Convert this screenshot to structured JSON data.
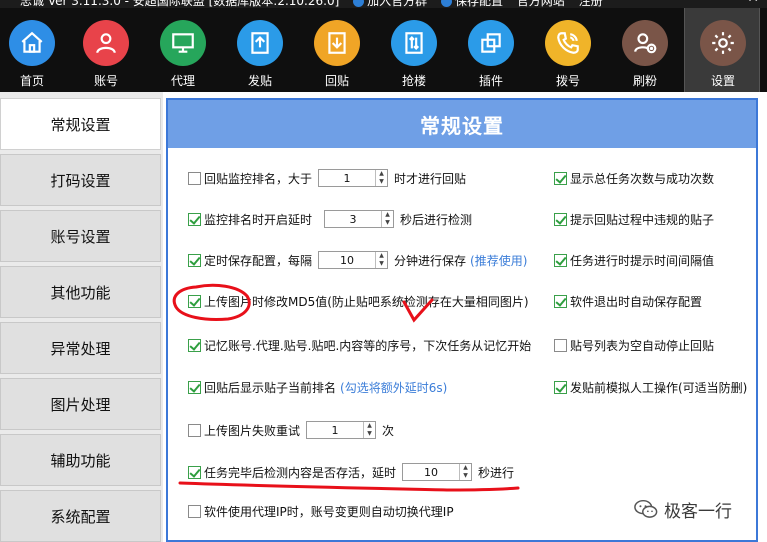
{
  "titlebar": {
    "title": "忠诚 Ver 3.11.3.0 - 安超国际联盟 [数据库版本:2.10.26.0]",
    "links": [
      "加入官方群",
      "保存配置",
      "官方网站",
      "注册"
    ],
    "close": "✕"
  },
  "toolbar": {
    "items": [
      {
        "label": "首页",
        "icon": "home-icon",
        "color": "#2e8ee6"
      },
      {
        "label": "账号",
        "icon": "user-icon",
        "color": "#e8434a"
      },
      {
        "label": "代理",
        "icon": "monitor-icon",
        "color": "#26a65b"
      },
      {
        "label": "发贴",
        "icon": "upload-icon",
        "color": "#2b9be8"
      },
      {
        "label": "回贴",
        "icon": "download-icon",
        "color": "#f0a526"
      },
      {
        "label": "抢楼",
        "icon": "sort-icon",
        "color": "#2b9be8"
      },
      {
        "label": "插件",
        "icon": "layers-icon",
        "color": "#2b9be8"
      },
      {
        "label": "拨号",
        "icon": "phone-icon",
        "color": "#f0b429"
      },
      {
        "label": "刷粉",
        "icon": "add-user-icon",
        "color": "#7a5548"
      },
      {
        "label": "设置",
        "icon": "gear-icon",
        "color": "#7a5548"
      }
    ],
    "active_index": 9
  },
  "sidebar": {
    "items": [
      "常规设置",
      "打码设置",
      "账号设置",
      "其他功能",
      "异常处理",
      "图片处理",
      "辅助功能",
      "系统配置"
    ],
    "active_index": 0
  },
  "panel": {
    "title": "常规设置",
    "left_options": [
      {
        "pre": "回贴监控排名，大于",
        "value": "1",
        "post": "时才进行回贴",
        "checked": false
      },
      {
        "pre": "监控排名时开启延时",
        "value": "3",
        "post": "秒后进行检测",
        "checked": true
      },
      {
        "pre": "定时保存配置，每隔",
        "value": "10",
        "post": "分钟进行保存",
        "hint": "(推荐使用)",
        "checked": true
      },
      {
        "pre": "上传图片时修改MD5值(防止贴吧系统检测存在大量相同图片)",
        "checked": true
      },
      {
        "pre": "记忆账号.代理.贴号.贴吧.内容等的序号，下次任务从记忆开始",
        "checked": true
      },
      {
        "pre": "回贴后显示贴子当前排名",
        "hint": "(勾选将额外延时6s)",
        "checked": true
      },
      {
        "pre": "上传图片失败重试",
        "value": "1",
        "post": "次",
        "checked": false
      },
      {
        "pre": "任务完毕后检测内容是否存活，延时",
        "value": "10",
        "post": "秒进行",
        "checked": true
      },
      {
        "pre": "软件使用代理IP时，账号变更则自动切换代理IP",
        "checked": false
      }
    ],
    "right_options": [
      {
        "label": "显示总任务次数与成功次数",
        "checked": true
      },
      {
        "label": "提示回贴过程中违规的贴子",
        "checked": true
      },
      {
        "label": "任务进行时提示时间间隔值",
        "checked": true
      },
      {
        "label": "软件退出时自动保存配置",
        "checked": true
      },
      {
        "label": "贴号列表为空自动停止回贴",
        "checked": false
      },
      {
        "label": "发贴前模拟人工操作(可适当防删)",
        "checked": true
      }
    ]
  },
  "watermark": {
    "text": "极客一行",
    "icon": "wechat-icon"
  },
  "colors": {
    "accent": "#3c78d8",
    "header": "#6f9fe6",
    "check": "#2e9e3e",
    "annotation": "#e8101a"
  }
}
